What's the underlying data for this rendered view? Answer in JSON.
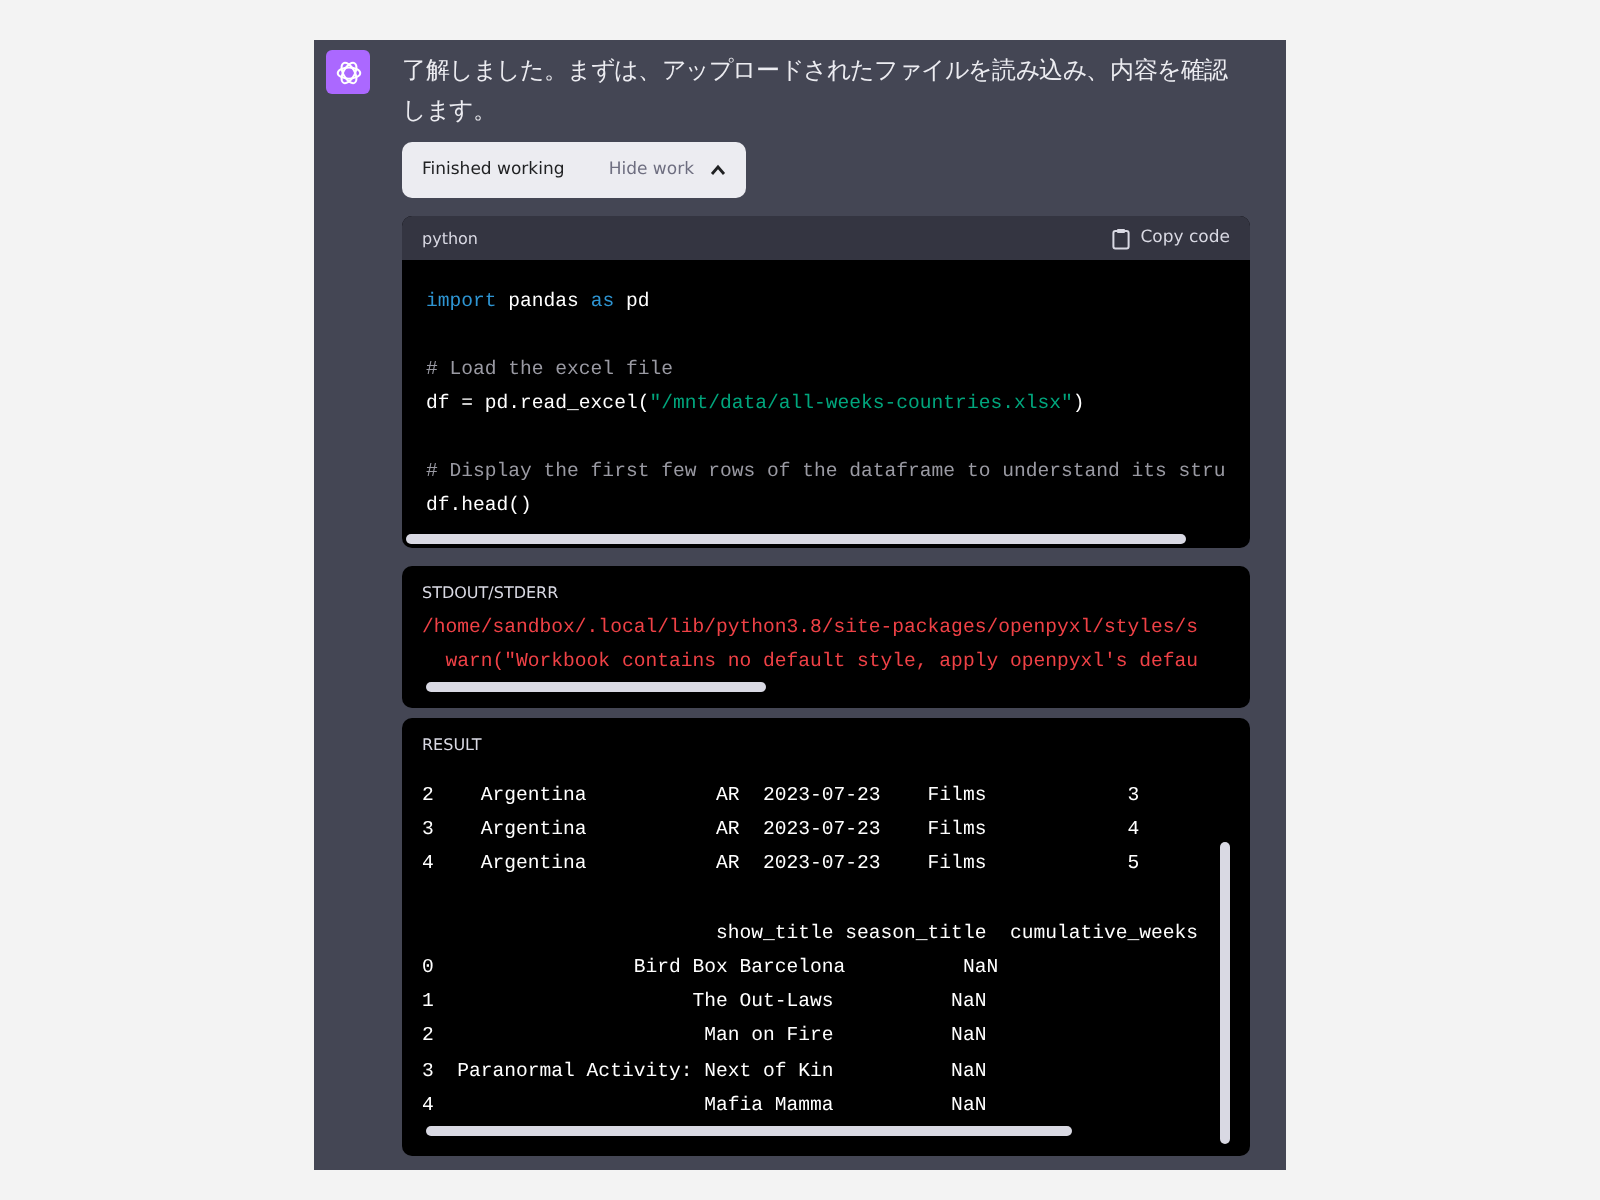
{
  "message": {
    "text": "了解しました。まずは、アップロードされたファイルを読み込み、内容を確認します。"
  },
  "work_toggle": {
    "label": "Finished working",
    "action": "Hide work",
    "expanded": true
  },
  "code_block": {
    "language": "python",
    "copy_label": "Copy code",
    "paragraphs": [
      [
        [
          {
            "kind": "keyword",
            "text": "import"
          },
          {
            "kind": "plain",
            "text": " pandas "
          },
          {
            "kind": "keyword",
            "text": "as"
          },
          {
            "kind": "plain",
            "text": " pd"
          }
        ]
      ],
      [
        [
          {
            "kind": "comment",
            "text": "# Load the excel file"
          }
        ],
        [
          {
            "kind": "plain",
            "text": "df = pd.read_excel("
          },
          {
            "kind": "string",
            "text": "\"/mnt/data/all-weeks-countries.xlsx\""
          },
          {
            "kind": "plain",
            "text": ")"
          }
        ]
      ],
      [
        [
          {
            "kind": "comment",
            "text": "# Display the first few rows of the dataframe to understand its stru"
          }
        ],
        [
          {
            "kind": "plain",
            "text": "df.head()"
          }
        ]
      ]
    ]
  },
  "stdout": {
    "label": "STDOUT/STDERR",
    "lines": [
      "/home/sandbox/.local/lib/python3.8/site-packages/openpyxl/styles/s",
      "  warn(\"Workbook contains no default style, apply openpyxl's defau"
    ]
  },
  "result": {
    "label": "RESULT",
    "tables": [
      [
        "2    Argentina           AR  2023-07-23    Films            3",
        "3    Argentina           AR  2023-07-23    Films            4",
        "4    Argentina           AR  2023-07-23    Films            5"
      ],
      [
        "                         show_title season_title  cumulative_weeks",
        "0                 Bird Box Barcelona          NaN",
        "1                      The Out-Laws          NaN",
        "2                       Man on Fire          NaN",
        "3  Paranormal Activity: Next of Kin          NaN",
        "4                       Mafia Mamma          NaN"
      ]
    ]
  }
}
